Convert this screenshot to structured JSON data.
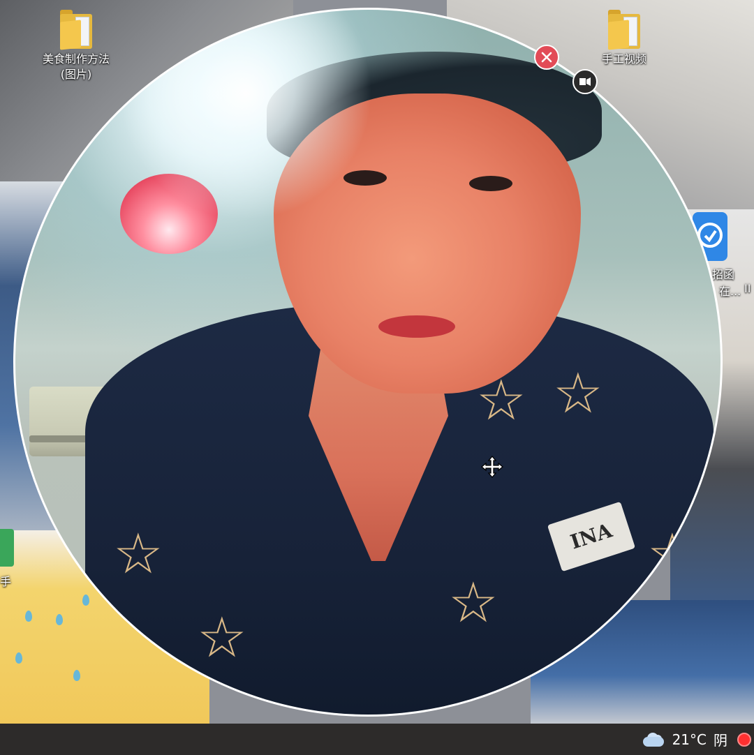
{
  "desktop": {
    "icons": [
      {
        "label_line1": "美食制作方法",
        "label_line2": "(图片)",
        "icon": "folder-icon"
      },
      {
        "label_line1": "手工视频",
        "label_line2": "",
        "icon": "folder-icon"
      }
    ],
    "partial_labels": {
      "right_icon_line1": "招函",
      "right_icon_line2": "在...",
      "right_icon_line2_extra": "II",
      "left_icon": "手"
    }
  },
  "camera_overlay": {
    "badge_text": "INA",
    "controls": {
      "close": "close-icon",
      "camera_toggle": "camera-icon",
      "cursor": "move-cursor-icon"
    }
  },
  "taskbar": {
    "weather": {
      "temperature": "21°C",
      "condition": "阴",
      "icon": "cloud-icon"
    },
    "record_indicator_color": "#ff3030"
  }
}
